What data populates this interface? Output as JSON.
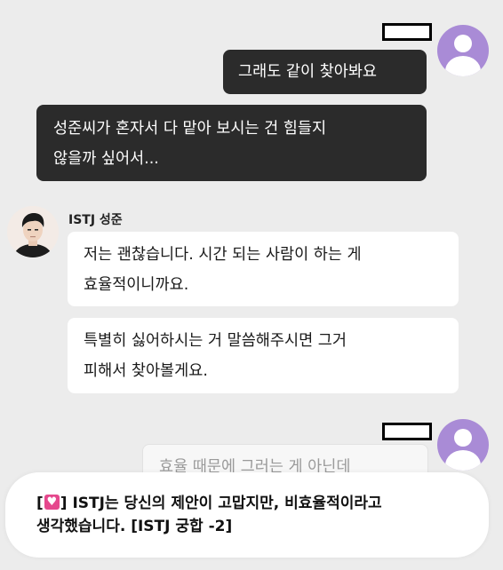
{
  "messages": {
    "user_1": "그래도 같이 찾아봐요",
    "user_2_line1": "성준씨가 혼자서 다 맡아 보시는 건 힘들지",
    "user_2_line2": "않을까 싶어서...",
    "bot_name": "ISTJ 성준",
    "bot_1_line1": "저는 괜찮습니다. 시간 되는 사람이 하는 게",
    "bot_1_line2": "효율적이니까요.",
    "bot_2_line1": "특별히 싫어하시는 거 말씀해주시면 그거",
    "bot_2_line2": "피해서 찾아볼게요.",
    "user_3_partial": "효율 때문에 그러는 게 아닌데"
  },
  "toast": {
    "bracket_open": "[",
    "bracket_close": "]",
    "line1": " ISTJ는 당신의 제안이 고맙지만, 비효율적이라고",
    "line2": "생각했습니다. [ISTJ 궁합 -2]",
    "icon": "broken-heart-icon"
  },
  "colors": {
    "background": "#ececec",
    "user_bubble": "#2b2b2b",
    "bot_bubble": "#ffffff",
    "user_avatar": "#a98bd6",
    "heart": "#e5488d"
  }
}
